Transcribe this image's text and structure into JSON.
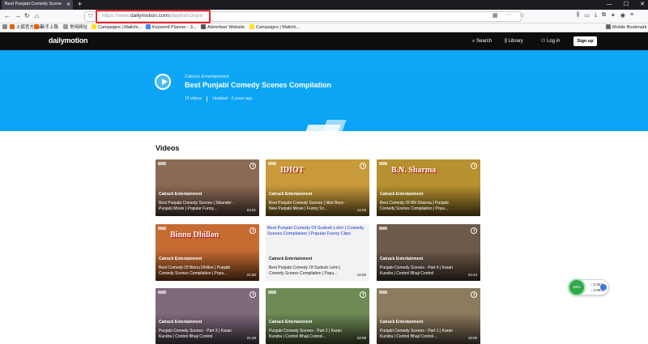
{
  "browser": {
    "tab_title": "Best Punjabi Comedy Scene",
    "url_prefix": "https://www.",
    "url_domain": "dailymotion.com",
    "url_path": "/playlist/x3vyur",
    "bookmarks": [
      {
        "label": "火狐官方站点",
        "color": "#e66000"
      },
      {
        "label": "新手上路",
        "color": "#e66000"
      },
      {
        "label": "常用网址",
        "color": "#999999"
      },
      {
        "label": "Campaigns | Mailchi...",
        "color": "#ffe01b"
      },
      {
        "label": "Keyword Planner - 3...",
        "color": "#4285f4"
      },
      {
        "label": "Advertiser Website",
        "color": "#555555"
      },
      {
        "label": "Campaigns | Mailchi...",
        "color": "#ffe01b"
      }
    ],
    "mobile_bookmarks": "Mobile Bookmark"
  },
  "header": {
    "logo": "dailymotion",
    "search": "Search",
    "library": "Library",
    "login": "Log in",
    "signup": "Sign up"
  },
  "hero": {
    "owner": "Catrack Entertainment",
    "title": "Best Punjabi Comedy Scenes Compilation",
    "videos": "19 videos",
    "updated": "Updated : 2 years ago"
  },
  "section_title": "Videos",
  "videos": [
    {
      "owner": "Catrack Entertainment",
      "title": "Best Punjabi Comedy Scenes | Sikander - Punjabi Movie | Popular Funny...",
      "duration": "04:01",
      "thumb": "#8b6a55"
    },
    {
      "owner": "Catrack Entertainment",
      "title": "Best Punjabi Comedy Scenes | Idiot Boys - New Punjabi Movie | Funny Sc...",
      "duration": "12:03",
      "thumb": "#c89a3a",
      "overlay": "IDIOT"
    },
    {
      "owner": "Catrack Entertainment",
      "title": "Best Comedy Of BN Sharma | Punjabi Comedy Scenes Compilation | Popu...",
      "duration": "",
      "thumb": "#b7902f",
      "overlay": "B.N. Sharma"
    },
    {
      "owner": "Catrack Entertainment",
      "title": "Best Comedy Of Binnu Dhillon | Punjabi Comedy Scenes Compilation | Popu...",
      "duration": "21:50",
      "thumb": "#c56b32",
      "overlay": "Binnu Dhillon"
    },
    {
      "owner": "Catrack Entertainment",
      "title": "Best Punjabi Comedy Of Sudesh Lehri | Comedy Scenes Compilation | Papu...",
      "duration": "10:05",
      "thumb": "#f2f2f2",
      "top_title": "Best Punjabi Comedy Of Sudesh Lehri | Comedy Scenes Compilation | Popular Funny Clips"
    },
    {
      "owner": "Catrack Entertainment",
      "title": "Punjabi Comedy Scenes - Part 4 | Karan Kundra | Control Bhaji Control",
      "duration": "24:43",
      "thumb": "#6d5a4b"
    },
    {
      "owner": "Catrack Entertainment",
      "title": "Punjabi Comedy Scenes - Part 3 | Karan Kundra | Control Bhaji Control",
      "duration": "21:49",
      "thumb": "#7e6a7a"
    },
    {
      "owner": "Catrack Entertainment",
      "title": "Punjabi Comedy Scenes - Part 2 | Karan Kundra | Control Bhaji Control...",
      "duration": "22:08",
      "thumb": "#6f8a55"
    },
    {
      "owner": "Catrack Entertainment",
      "title": "Punjabi Comedy Scenes - Part 1 | Karan Kundra | Control Bhaji Control...",
      "duration": "19:09",
      "thumb": "#8c7b5e"
    }
  ],
  "net_widget": {
    "percent": "83%",
    "up": "2.3K/s",
    "down": "2.9K/s"
  }
}
